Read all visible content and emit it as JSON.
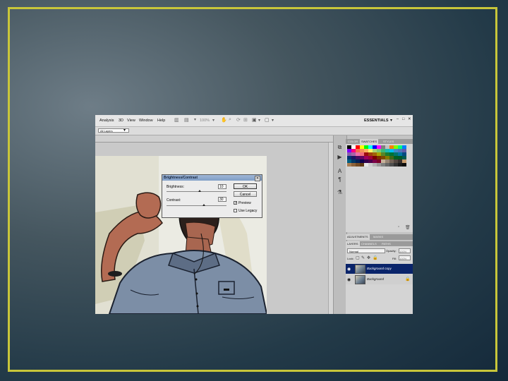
{
  "menubar": {
    "items": [
      "Analysis",
      "3D",
      "View",
      "Window",
      "Help"
    ],
    "zoom": "100%",
    "workspace": "ESSENTIALS",
    "window_controls": [
      "–",
      "□",
      "✕"
    ]
  },
  "options": {
    "sample": "All Layers"
  },
  "swatches": {
    "tabs": [
      "COLOR",
      "SWATCHES",
      "STYLES"
    ],
    "colors": [
      "#000000",
      "#ffffff",
      "#ff0000",
      "#ffff00",
      "#00ff00",
      "#00ffff",
      "#0000ff",
      "#ff00ff",
      "#7f7f7f",
      "#c0c0c0",
      "#ff7f00",
      "#7fff00",
      "#00ff7f",
      "#007fff",
      "#7f00ff",
      "#ff007f",
      "#f26c4f",
      "#f68e55",
      "#fbaf5c",
      "#fff467",
      "#acd372",
      "#7cc576",
      "#3bb878",
      "#1abbb4",
      "#00bff3",
      "#438ccb",
      "#5574b9",
      "#605ca8",
      "#855fa8",
      "#a763a8",
      "#f06ea9",
      "#f26d7d",
      "#9e0b0f",
      "#a0410d",
      "#a36209",
      "#aba000",
      "#598527",
      "#1a7b30",
      "#007236",
      "#00746b",
      "#0076a3",
      "#004b80",
      "#003471",
      "#1b1464",
      "#440e62",
      "#630460",
      "#9e005d",
      "#9e0039",
      "#790000",
      "#7b2e00",
      "#7d4900",
      "#827b00",
      "#406618",
      "#005e20",
      "#005826",
      "#005952",
      "#005b7f",
      "#003663",
      "#002157",
      "#0d004c",
      "#32004b",
      "#4b0049",
      "#7b0046",
      "#7a0026",
      "#c7b299",
      "#998675",
      "#736357",
      "#534741",
      "#37302d",
      "#c69c6d",
      "#a67c52",
      "#8c6239",
      "#754c24",
      "#603913",
      "#e6e6e6",
      "#cccccc",
      "#b3b3b3",
      "#999999",
      "#808080",
      "#666666",
      "#4d4d4d",
      "#333333",
      "#1a1a1a",
      "#0d0d0d"
    ]
  },
  "adjustments": {
    "tabs": [
      "ADJUSTMENTS",
      "MASKS"
    ]
  },
  "layers_panel": {
    "tabs": [
      "LAYERS",
      "CHANNELS",
      "PATHS"
    ],
    "blend_mode": "Normal",
    "opacity_label": "Opacity:",
    "opacity_value": "100%",
    "lock_label": "Lock:",
    "fill_label": "Fill:",
    "fill_value": "100%",
    "layers": [
      {
        "name": "Background copy",
        "selected": true
      },
      {
        "name": "Background",
        "selected": false
      }
    ]
  },
  "dialog": {
    "title": "Brightness/Contrast",
    "brightness_label": "Brightness:",
    "brightness_value": "10",
    "brightness_level": 0.55,
    "contrast_label": "Contrast:",
    "contrast_value": "30",
    "contrast_level": 0.62,
    "ok_label": "OK",
    "cancel_label": "Cancel",
    "preview_label": "Preview",
    "preview_checked": true,
    "legacy_label": "Use Legacy",
    "legacy_checked": false
  },
  "colors": {
    "frame": "#c8c63a",
    "layer_selected": "#0a246a"
  }
}
